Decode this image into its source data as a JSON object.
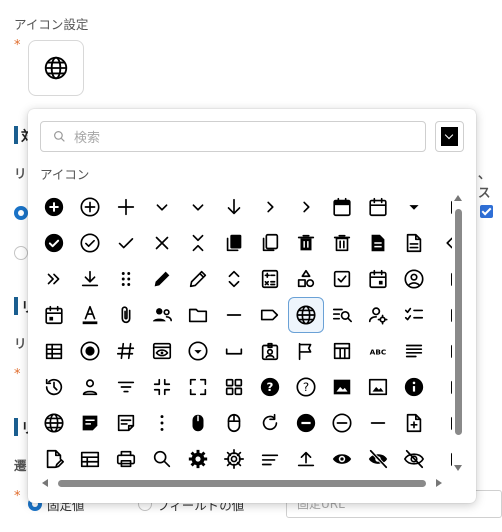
{
  "form": {
    "icon_setting_label": "アイコン設定",
    "required_mark": "*",
    "selected_icon": "globe-icon",
    "bottom_fields": {
      "fixed_value": "固定値",
      "field_value": "フィールドの値",
      "url_placeholder": "固定URL"
    }
  },
  "picker": {
    "search_placeholder": "検索",
    "category_label": "アイコン",
    "color": "#000000",
    "selected_icon": "globe-icon",
    "icons": [
      [
        "add-circle-filled",
        "add-circle-outline",
        "plus",
        "chevron-down",
        "chevron-down",
        "arrow-down",
        "chevron-right",
        "chevron-right",
        "calendar-filled",
        "calendar-outline",
        "caret-down",
        "partial"
      ],
      [
        "check-circle-filled",
        "check-circle-outline",
        "check",
        "close",
        "unfold-less",
        "copy-filled",
        "copy-outline",
        "delete-filled",
        "delete-outline",
        "document-filled",
        "document-outline",
        "chevron-left"
      ],
      [
        "double-chevron-right",
        "download",
        "drag-handle",
        "edit-filled",
        "edit-outline",
        "unfold-more",
        "calculator",
        "shapes",
        "checkbox",
        "calendar-event",
        "account-circle",
        "partial"
      ],
      [
        "calendar-today",
        "text-color",
        "attachment",
        "group",
        "folder",
        "minus",
        "label",
        "globe",
        "find-in-page",
        "manage-accounts",
        "checklist",
        "partial"
      ],
      [
        "table-view",
        "radio-checked",
        "tag",
        "visibility-box",
        "arrow-drop-down-circle",
        "space-bar",
        "badge",
        "flag",
        "table-chart",
        "abc",
        "notes",
        "partial"
      ],
      [
        "history",
        "person",
        "filter-list",
        "fullscreen-exit",
        "fullscreen",
        "grid-view",
        "help-filled",
        "help-outline",
        "image-filled",
        "image-outline",
        "info-filled",
        "partial"
      ],
      [
        "globe",
        "note-filled",
        "note-outline",
        "more-vertical",
        "mouse-filled",
        "mouse-outline",
        "refresh",
        "remove-circle-filled",
        "remove-circle-outline",
        "remove",
        "note-add",
        "partial"
      ],
      [
        "edit-document",
        "table",
        "print",
        "search",
        "settings-filled",
        "settings-outline",
        "short-text",
        "upload",
        "visibility",
        "visibility-off-filled",
        "visibility-off-outline",
        "partial"
      ]
    ]
  }
}
